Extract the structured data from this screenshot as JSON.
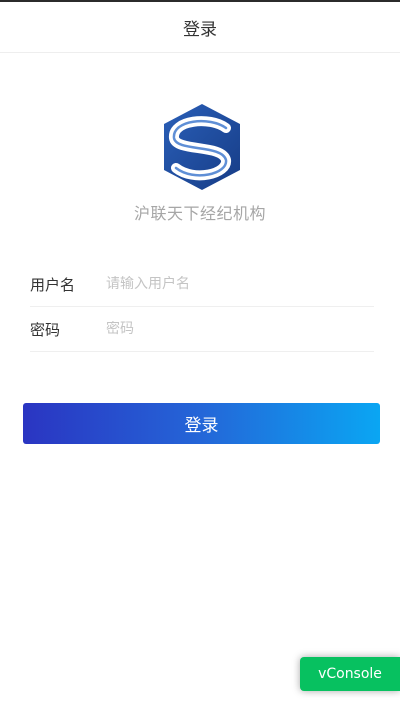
{
  "header": {
    "title": "登录"
  },
  "brand": {
    "org_name": "沪联天下经纪机构",
    "logo_icon": "s-hexagon-logo-icon",
    "logo_color": "#1f4fa3"
  },
  "form": {
    "username": {
      "label": "用户名",
      "placeholder": "请输入用户名",
      "value": ""
    },
    "password": {
      "label": "密码",
      "placeholder": "密码",
      "value": ""
    }
  },
  "actions": {
    "login_label": "登录"
  },
  "debug": {
    "vconsole_label": "vConsole"
  }
}
